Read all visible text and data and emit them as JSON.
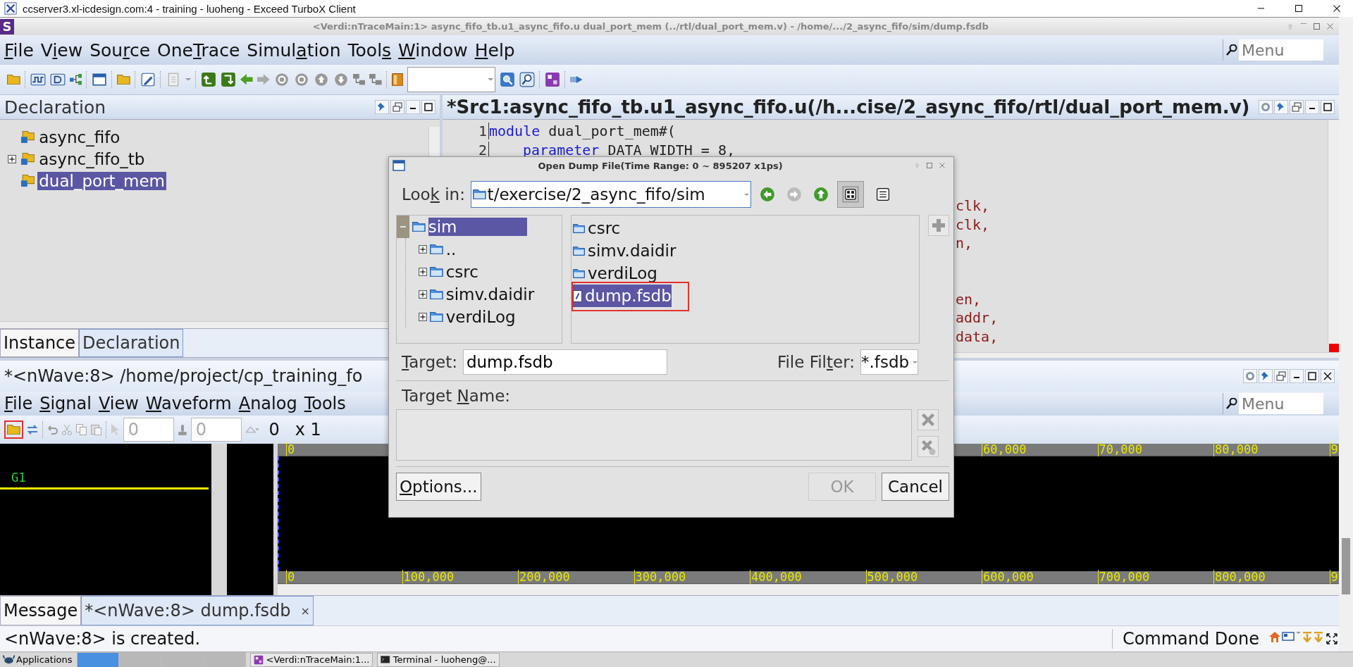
{
  "window": {
    "title": "ccserver3.xl-icdesign.com:4 - training - luoheng - Exceed TurboX Client"
  },
  "app": {
    "logo": "S",
    "title": "<Verdi:nTraceMain:1> async_fifo_tb.u1_async_fifo.u dual_port_mem (../rtl/dual_port_mem.v) - /home/.../2_async_fifo/sim/dump.fsdb"
  },
  "menu": [
    {
      "segments": [
        {
          "text": "F",
          "underline": true
        },
        {
          "text": "ile",
          "underline": false
        }
      ]
    },
    {
      "segments": [
        {
          "text": "V",
          "underline": false
        },
        {
          "text": "i",
          "underline": true
        },
        {
          "text": "ew",
          "underline": false
        }
      ]
    },
    {
      "segments": [
        {
          "text": "Sou",
          "underline": false
        },
        {
          "text": "r",
          "underline": true
        },
        {
          "text": "ce",
          "underline": false
        }
      ]
    },
    {
      "segments": [
        {
          "text": "One",
          "underline": false
        },
        {
          "text": "T",
          "underline": true
        },
        {
          "text": "race",
          "underline": false
        }
      ]
    },
    {
      "segments": [
        {
          "text": "Simul",
          "underline": false
        },
        {
          "text": "a",
          "underline": true
        },
        {
          "text": "tion",
          "underline": false
        }
      ]
    },
    {
      "segments": [
        {
          "text": "Tool",
          "underline": false
        },
        {
          "text": "s",
          "underline": true
        }
      ]
    },
    {
      "segments": [
        {
          "text": "W",
          "underline": true
        },
        {
          "text": "indow",
          "underline": false
        }
      ]
    },
    {
      "segments": [
        {
          "text": "H",
          "underline": true
        },
        {
          "text": "elp",
          "underline": false
        }
      ]
    }
  ],
  "menu_search": {
    "placeholder": "Menu"
  },
  "declaration_panel": {
    "title": "Declaration",
    "tree": [
      {
        "label": "async_fifo",
        "kind": "leaf",
        "selected": false
      },
      {
        "label": "async_fifo_tb",
        "kind": "collapsed",
        "selected": false
      },
      {
        "label": "dual_port_mem",
        "kind": "leaf",
        "selected": true
      }
    ]
  },
  "panel_tabs": [
    {
      "label": "Instance",
      "selected": false
    },
    {
      "label": "Declaration",
      "selected": true
    }
  ],
  "source_panel": {
    "title": "*Src1:async_fifo_tb.u1_async_fifo.u(/h...cise/2_async_fifo/rtl/dual_port_mem.v)",
    "lines": [
      {
        "number": "1",
        "indented": false,
        "tokens": [
          {
            "kind": "keyword",
            "text": "module"
          },
          {
            "kind": "plain",
            "text": " dual_port_mem#("
          }
        ]
      },
      {
        "number": "2",
        "indented": true,
        "tokens": [
          {
            "kind": "keyword",
            "text": "parameter"
          },
          {
            "kind": "plain",
            "text": " DATA WIDTH = 8,"
          }
        ]
      }
    ],
    "fragment_groups": [
      [
        "clk,",
        "clk,",
        "n,"
      ],
      [
        "en,",
        "addr,",
        "data,"
      ]
    ]
  },
  "nwave": {
    "title": "*<nWave:8> /home/project/cp_training_fo",
    "menu": [
      {
        "segments": [
          {
            "text": "F",
            "underline": true
          },
          {
            "text": "ile",
            "underline": false
          }
        ]
      },
      {
        "segments": [
          {
            "text": "S",
            "underline": true
          },
          {
            "text": "ignal",
            "underline": false
          }
        ]
      },
      {
        "segments": [
          {
            "text": "V",
            "underline": true
          },
          {
            "text": "iew",
            "underline": false
          }
        ]
      },
      {
        "segments": [
          {
            "text": "W",
            "underline": true
          },
          {
            "text": "aveform",
            "underline": false
          }
        ]
      },
      {
        "segments": [
          {
            "text": "A",
            "underline": true
          },
          {
            "text": "nalog",
            "underline": false
          }
        ]
      },
      {
        "segments": [
          {
            "text": "T",
            "underline": true
          },
          {
            "text": "ools",
            "underline": false
          }
        ]
      }
    ],
    "search": {
      "placeholder": "Menu"
    },
    "toolbar": {
      "open_annotated": true,
      "cursor_time": "0",
      "marker_time": "0",
      "delta": "0",
      "zoom": "x 1"
    },
    "groups": [
      "G1"
    ],
    "top_ruler": {
      "first": "0",
      "rest": [
        "60,000",
        "70,000",
        "80,000",
        "9"
      ]
    },
    "bottom_ruler": [
      "0",
      "100,000",
      "200,000",
      "300,000",
      "400,000",
      "500,000",
      "600,000",
      "700,000",
      "800,000",
      "9"
    ]
  },
  "message_tabs": [
    {
      "label": "Message",
      "selected": false
    },
    {
      "label": "*<nWave:8> dump.fsdb",
      "selected": true,
      "close": "×"
    }
  ],
  "status": {
    "message": "<nWave:8> is created.",
    "state": "Command Done"
  },
  "taskbar": {
    "start": "Applications",
    "workspaces": [
      {
        "selected": true
      },
      {
        "selected": false
      },
      {
        "selected": false
      },
      {
        "selected": false
      }
    ],
    "tasks": [
      {
        "label": "<Verdi:nTraceMain:1...",
        "kind": "verdi"
      },
      {
        "label": "Terminal - luoheng@...",
        "kind": "terminal"
      }
    ]
  },
  "dialog": {
    "title": "Open Dump File(Time Range: 0 ~ 895207 x1ps)",
    "look_in": {
      "label": [
        {
          "text": "Loo",
          "underline": false
        },
        {
          "text": "k",
          "underline": true
        },
        {
          "text": " in:",
          "underline": false
        }
      ],
      "value": "t/exercise/2_async_fifo/sim"
    },
    "tree": [
      {
        "label": "sim",
        "expanded": true,
        "selected": true,
        "children": [
          {
            "label": "..",
            "expanded": false,
            "selected": false
          },
          {
            "label": "csrc",
            "expanded": false,
            "selected": false
          },
          {
            "label": "simv.daidir",
            "expanded": false,
            "selected": false
          },
          {
            "label": "verdiLog",
            "expanded": false,
            "selected": false
          }
        ]
      }
    ],
    "files": [
      {
        "label": "csrc",
        "kind": "folder",
        "selected": false,
        "annotated": false
      },
      {
        "label": "simv.daidir",
        "kind": "folder",
        "selected": false,
        "annotated": false
      },
      {
        "label": "verdiLog",
        "kind": "folder",
        "selected": false,
        "annotated": false
      },
      {
        "label": "dump.fsdb",
        "kind": "file",
        "selected": true,
        "annotated": true
      }
    ],
    "target": {
      "label": [
        {
          "text": "T",
          "underline": true
        },
        {
          "text": "arget:",
          "underline": false
        }
      ],
      "value": "dump.fsdb"
    },
    "filter": {
      "label": [
        {
          "text": "File Fil",
          "underline": false
        },
        {
          "text": "t",
          "underline": true
        },
        {
          "text": "er:",
          "underline": false
        }
      ],
      "value": "*.fsdb"
    },
    "target_name": {
      "label": [
        {
          "text": "Target ",
          "underline": false
        },
        {
          "text": "N",
          "underline": true
        },
        {
          "text": "ame:",
          "underline": false
        }
      ]
    },
    "buttons": [
      {
        "label": [
          {
            "text": "O",
            "underline": true
          },
          {
            "text": "ptions...",
            "underline": false
          }
        ],
        "disabled": false
      },
      {
        "label": [
          {
            "text": "OK",
            "underline": false
          }
        ],
        "disabled": true
      },
      {
        "label": [
          {
            "text": "Cancel",
            "underline": false
          }
        ],
        "disabled": false
      }
    ]
  }
}
